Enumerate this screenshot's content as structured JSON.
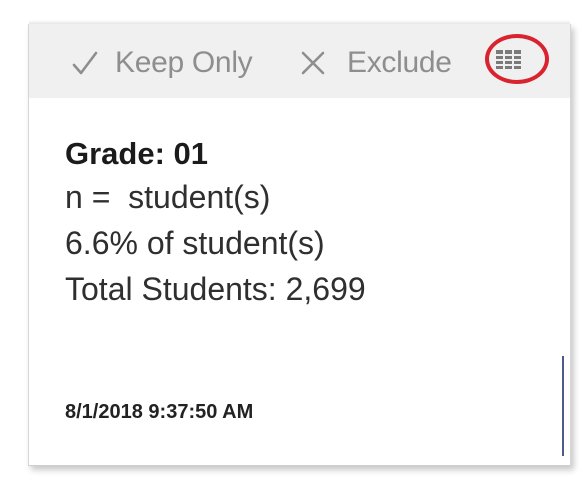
{
  "toolbar": {
    "keep_only_label": "Keep Only",
    "exclude_label": "Exclude",
    "keep_only_icon": "checkmark-icon",
    "exclude_icon": "x-icon",
    "view_data_icon": "view-data-grid-icon"
  },
  "tooltip": {
    "title": "Grade: 01",
    "count_line": "n =  student(s)",
    "percent_line": "6.6% of student(s)",
    "total_line": "Total Students: 2,699",
    "timestamp": "8/1/2018 9:37:50 AM"
  },
  "colors": {
    "toolbar_bg": "#f0f0f0",
    "toolbar_text": "#8e8e8e",
    "highlight_ring": "#d9232e",
    "body_text": "#2f2f2f"
  }
}
